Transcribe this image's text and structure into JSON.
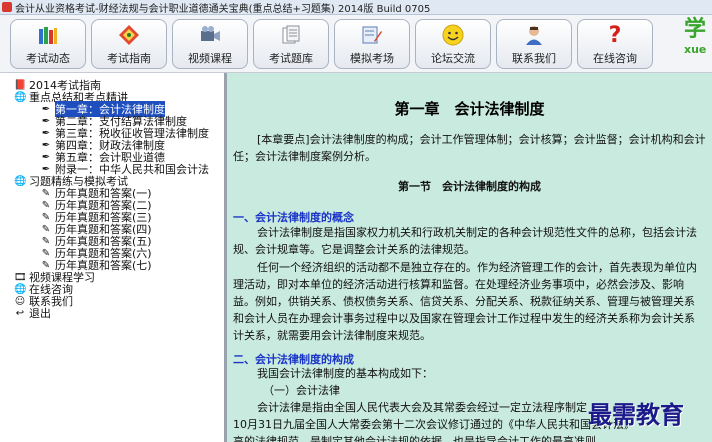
{
  "window": {
    "title": "会计从业资格考试-财经法规与会计职业道德通关宝典(重点总结+习题集) 2014版 Build 0705"
  },
  "toolbar": {
    "buttons": [
      {
        "label": "考试动态",
        "icon": "books-icon"
      },
      {
        "label": "考试指南",
        "icon": "compass-icon"
      },
      {
        "label": "视频课程",
        "icon": "video-camera-icon"
      },
      {
        "label": "考试题库",
        "icon": "papers-icon"
      },
      {
        "label": "模拟考场",
        "icon": "pencil-exam-icon"
      },
      {
        "label": "论坛交流",
        "icon": "smiley-icon"
      },
      {
        "label": "联系我们",
        "icon": "person-icon"
      },
      {
        "label": "在线咨询",
        "icon": "question-icon"
      }
    ],
    "logo_big": "学",
    "logo_small": "xue"
  },
  "tree": [
    {
      "label": "2014考试指南",
      "depth": 0,
      "icon": "book-icon"
    },
    {
      "label": "重点总结和考点精讲",
      "depth": 0,
      "icon": "globe-icon"
    },
    {
      "label": "第一章：会计法律制度",
      "depth": 1,
      "icon": "pen-icon",
      "selected": true
    },
    {
      "label": "第二章：支付结算法律制度",
      "depth": 1,
      "icon": "pen-icon"
    },
    {
      "label": "第三章：税收征收管理法律制度",
      "depth": 1,
      "icon": "pen-icon"
    },
    {
      "label": "第四章：财政法律制度",
      "depth": 1,
      "icon": "pen-icon"
    },
    {
      "label": "第五章：会计职业道德",
      "depth": 1,
      "icon": "pen-icon"
    },
    {
      "label": "附录一：中华人民共和国会计法",
      "depth": 1,
      "icon": "pen-icon"
    },
    {
      "label": "习题精练与模拟考试",
      "depth": 0,
      "icon": "globe-icon"
    },
    {
      "label": "历年真题和答案(一)",
      "depth": 1,
      "icon": "pencil-icon"
    },
    {
      "label": "历年真题和答案(二)",
      "depth": 1,
      "icon": "pencil-icon"
    },
    {
      "label": "历年真题和答案(三)",
      "depth": 1,
      "icon": "pencil-icon"
    },
    {
      "label": "历年真题和答案(四)",
      "depth": 1,
      "icon": "pencil-icon"
    },
    {
      "label": "历年真题和答案(五)",
      "depth": 1,
      "icon": "pencil-icon"
    },
    {
      "label": "历年真题和答案(六)",
      "depth": 1,
      "icon": "pencil-icon"
    },
    {
      "label": "历年真题和答案(七)",
      "depth": 1,
      "icon": "pencil-icon"
    },
    {
      "label": "视频课程学习",
      "depth": 0,
      "icon": "video-icon"
    },
    {
      "label": "在线咨询",
      "depth": 0,
      "icon": "globe-icon"
    },
    {
      "label": "联系我们",
      "depth": 0,
      "icon": "smiley-icon"
    },
    {
      "label": "退出",
      "depth": 0,
      "icon": "exit-icon"
    }
  ],
  "content": {
    "chapter_title": "第一章　会计法律制度",
    "summary_line1": "[本章要点]会计法律制度的构成；会计工作管理体制；会计核算；会计监督；会计机构和会计",
    "summary_line2": "任；会计法律制度案例分析。",
    "section1_title": "第一节　会计法律制度的构成",
    "heading1": "一、会计法律制度的概念",
    "p1_line1": "会计法律制度是指国家权力机关和行政机关制定的各种会计规范性文件的总称，包括会计法",
    "p1_line2": "规、会计规章等。它是调整会计关系的法律规范。",
    "p2_line1": "任何一个经济组织的活动都不是独立存在的。作为经济管理工作的会计，首先表现为单位内",
    "p2_line2": "理活动，即对本单位的经济活动进行核算和监督。在处理经济业务事项中，必然会涉及、影响",
    "p2_line3": "益。例如，供销关系、债权债务关系、信贷关系、分配关系、税款征纳关系、管理与被管理关系",
    "p2_line4": "和会计人员在办理会计事务过程中以及国家在管理会计工作过程中发生的经济关系称为会计关系",
    "p2_line5": "计关系，就需要用会计法律制度来规范。",
    "heading2": "二、会计法律制度的构成",
    "p3_line1": "我国会计法律制度的基本构成如下：",
    "p3_line2": "（一）会计法律",
    "p4_line1": "会计法律是指由全国人民代表大会及其常委会经过一定立法程序制定",
    "p4_line2": "10月31日九届全国人大常委会第十二次会议修订通过的《中华人民共和国会计法》",
    "p4_line3": "高的法律规范，是制定其他会计法规的依据，也是指导会计工作的最高准则。"
  },
  "watermark": "最需教育"
}
